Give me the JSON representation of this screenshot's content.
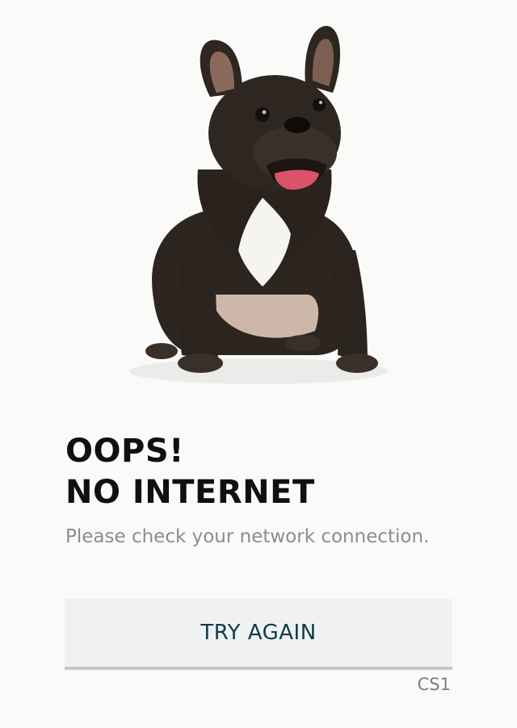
{
  "hero": {
    "image": "french-bulldog-illustration"
  },
  "message": {
    "title_line1": "OOPS!",
    "title_line2": "NO INTERNET",
    "subtitle": "Please check your network connection."
  },
  "actions": {
    "retry_label": "TRY AGAIN"
  },
  "footer": {
    "code": "CS1"
  },
  "colors": {
    "background": "#fafaf9",
    "title": "#0f1111",
    "subtitle": "#8a8d8f",
    "button_bg": "#f0f1f3",
    "button_text": "#0f3b48"
  }
}
